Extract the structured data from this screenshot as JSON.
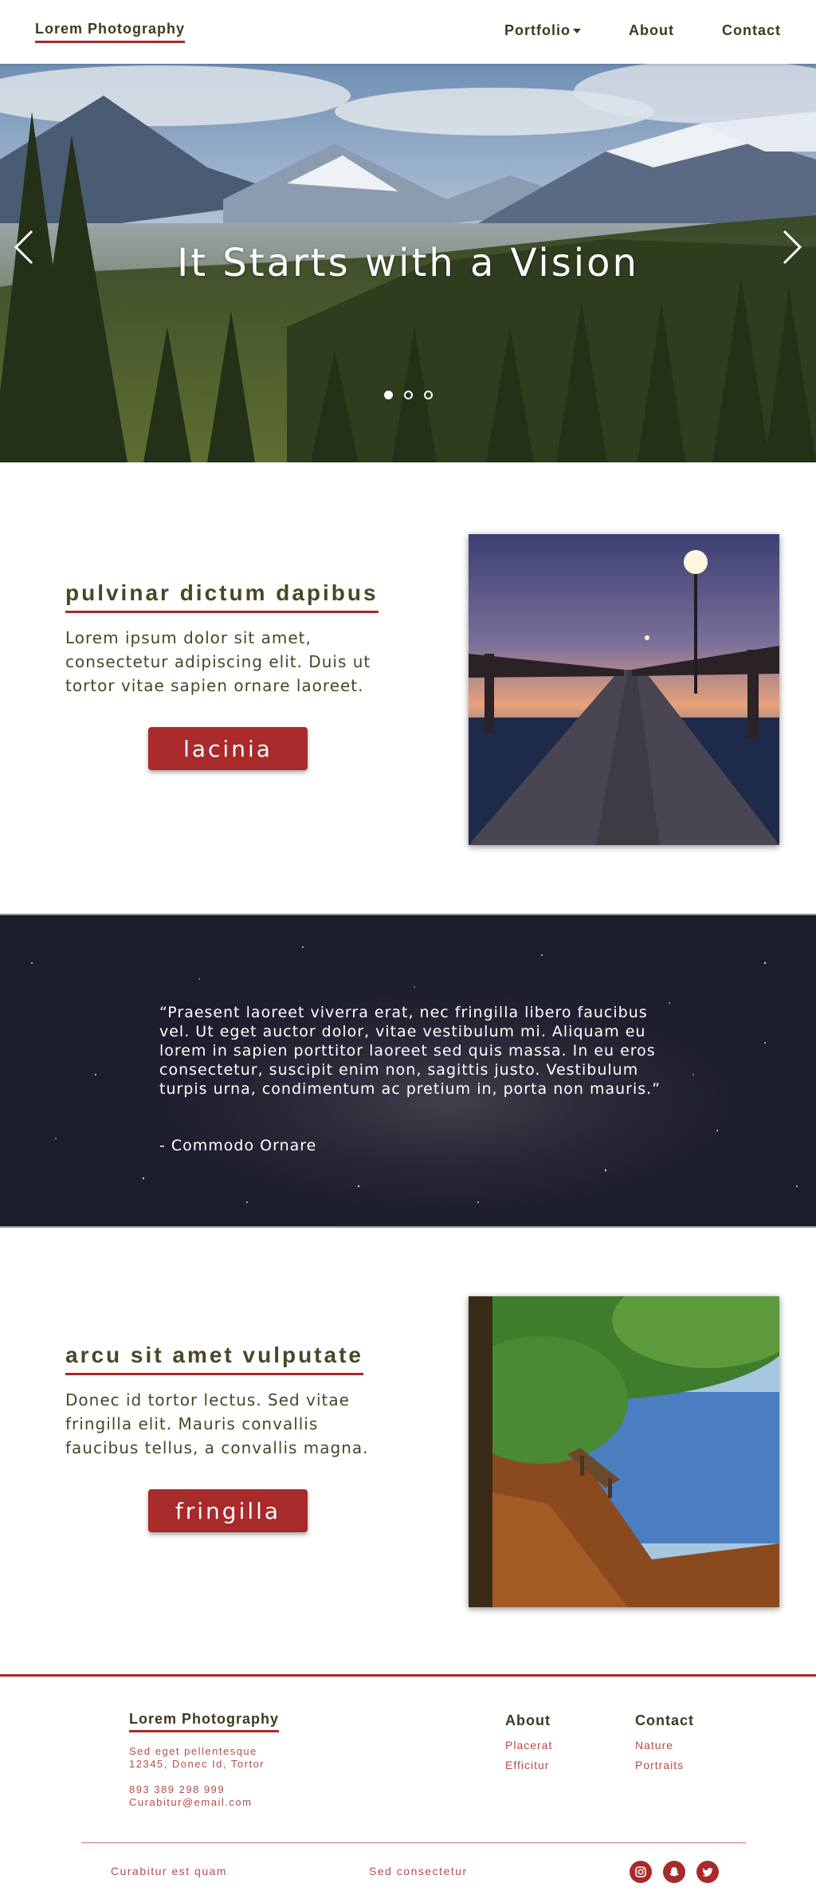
{
  "nav": {
    "brand": "Lorem Photography",
    "portfolio": "Portfolio",
    "about": "About",
    "contact": "Contact"
  },
  "hero": {
    "title": "It Starts with a Vision",
    "slides": 3,
    "active_slide": 1
  },
  "feature1": {
    "heading": "pulvinar dictum dapibus",
    "body": "Lorem ipsum dolor sit amet, consectetur adipiscing elit. Duis ut tortor vitae sapien ornare laoreet.",
    "button": "lacinia"
  },
  "quote": {
    "text": "“Praesent laoreet viverra erat, nec fringilla libero faucibus vel. Ut eget auctor dolor, vitae vestibulum mi. Aliquam eu lorem in sapien porttitor laoreet sed quis massa. In eu eros consectetur, suscipit enim non, sagittis justo. Vestibulum turpis urna, condimentum ac pretium in, porta non mauris.”",
    "author": "- Commodo Ornare"
  },
  "feature2": {
    "heading": "arcu sit amet vulputate",
    "body": "Donec id tortor lectus. Sed vitae fringilla elit. Mauris convallis faucibus tellus, a convallis magna.",
    "button": "fringilla"
  },
  "footer": {
    "brand": "Lorem Photography",
    "address1": "Sed eget pellentesque",
    "address2": "12345, Donec Id, Tortor",
    "phone": "893 389 298 999",
    "email": "Curabitur@email.com",
    "about_heading": "About",
    "about_links": [
      "Placerat",
      "Efficitur"
    ],
    "contact_heading": "Contact",
    "contact_links": [
      "Nature",
      "Portraits"
    ],
    "bottom_left": "Curabitur est quam",
    "bottom_middle": "Sed consectetur",
    "social": [
      "instagram-icon",
      "snapchat-icon",
      "twitter-icon"
    ]
  },
  "colors": {
    "accent": "#a82a2a",
    "text": "#4a4626"
  }
}
